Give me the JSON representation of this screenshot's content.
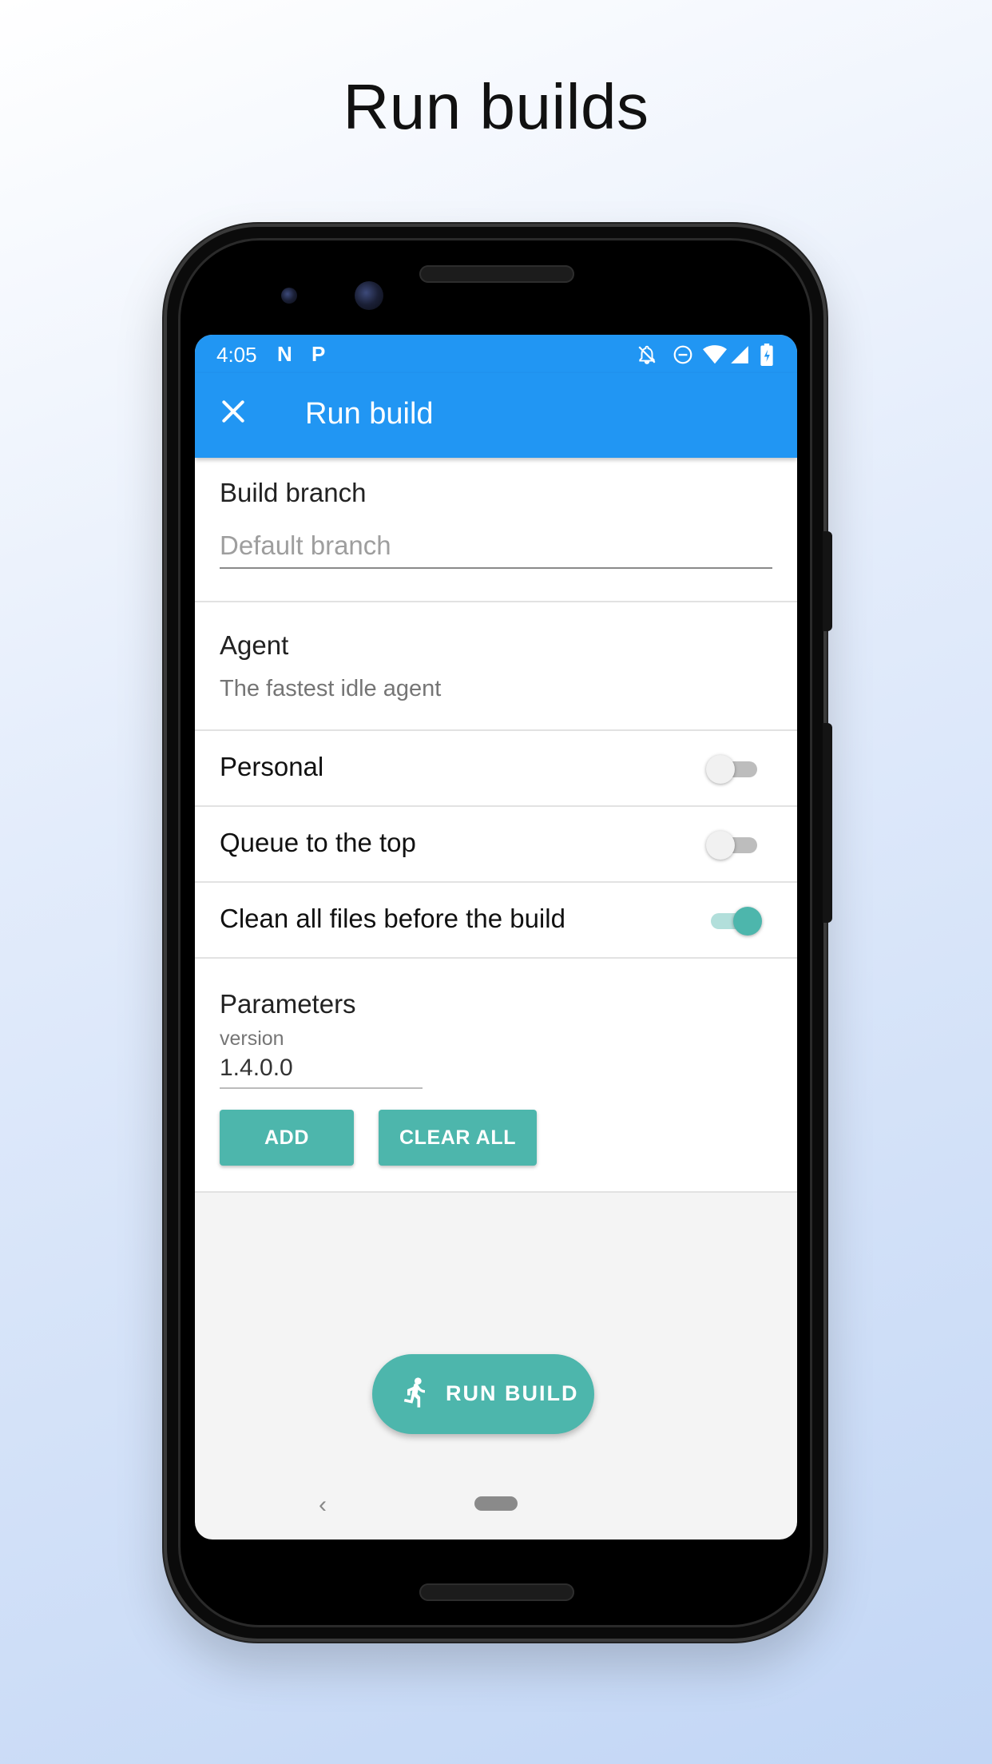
{
  "headline": "Run builds",
  "status_bar": {
    "time": "4:05",
    "notification_icons": [
      "N",
      "P"
    ]
  },
  "app_bar": {
    "title": "Run build",
    "close_icon": "close-icon"
  },
  "build_branch": {
    "label": "Build branch",
    "placeholder": "Default branch"
  },
  "agent": {
    "label": "Agent",
    "value": "The fastest idle agent"
  },
  "toggles": [
    {
      "label": "Personal",
      "checked": false
    },
    {
      "label": "Queue to the top",
      "checked": false
    },
    {
      "label": "Clean all files before the build",
      "checked": true
    }
  ],
  "parameters": {
    "label": "Parameters",
    "param_name": "version",
    "param_value": "1.4.0.0",
    "add_label": "ADD",
    "clear_label": "CLEAR ALL"
  },
  "fab": {
    "label": "RUN BUILD",
    "icon": "run-icon"
  },
  "navbar": {
    "back_glyph": "‹"
  },
  "colors": {
    "primary": "#2196f3",
    "accent": "#4db6ac"
  }
}
